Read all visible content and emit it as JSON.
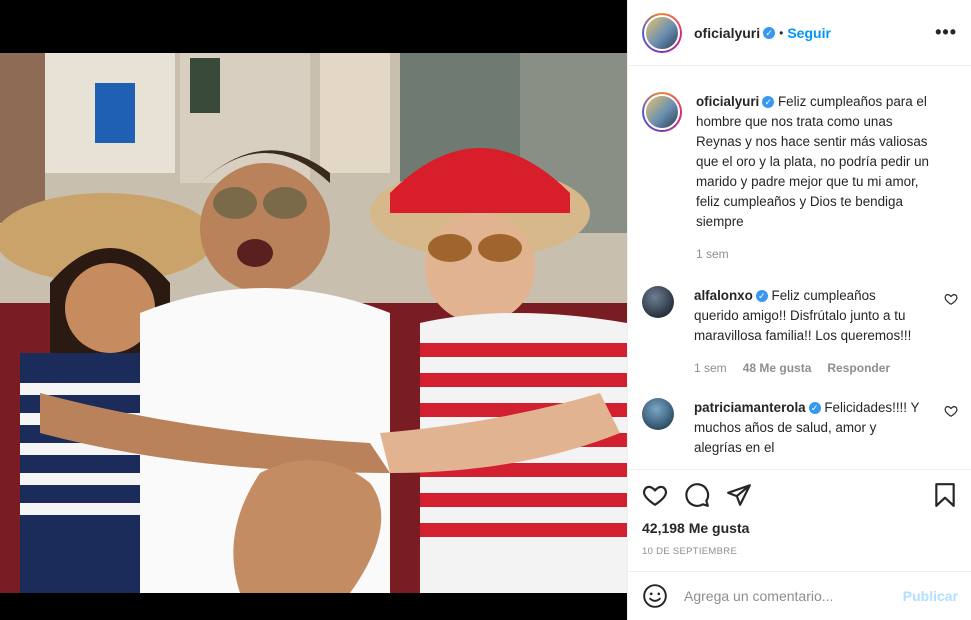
{
  "post": {
    "author": "oficialyuri",
    "follow_label": "Seguir",
    "more_label": "•••",
    "caption": "Feliz cumpleaños para el hombre que nos trata como unas Reynas y nos hace sentir más valiosas que el oro y la plata, no podría pedir un marido y padre mejor que tu mi amor, feliz cumpleaños y Dios te bendiga siempre",
    "caption_time": "1 sem",
    "likes": "42,198 Me gusta",
    "date": "10 DE SEPTIEMBRE"
  },
  "comments": [
    {
      "user": "alfalonxo",
      "text": "Feliz cumpleaños querido amigo!! Disfrútalo junto a tu maravillosa familia!! Los queremos!!!",
      "time": "1 sem",
      "likes": "48 Me gusta",
      "reply": "Responder"
    },
    {
      "user": "patriciamanterola",
      "text": "Felicidades!!!! Y muchos años de salud, amor y alegrías en el"
    }
  ],
  "add_comment": {
    "placeholder": "Agrega un comentario...",
    "post_label": "Publicar"
  },
  "icons": [
    "heart-icon",
    "comment-icon",
    "share-icon",
    "bookmark-icon",
    "emoji-icon",
    "verified-icon"
  ],
  "colors": {
    "link": "#0095f6",
    "verified": "#3897f0",
    "muted": "#8e8e8e",
    "post_disabled": "#b2dffc"
  }
}
